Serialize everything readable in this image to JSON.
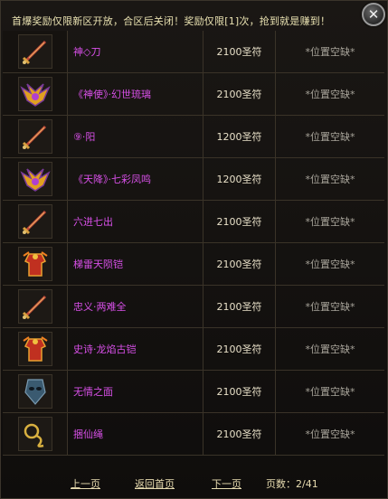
{
  "header": {
    "notice": "首爆奖励仅限新区开放，合区后关闭！奖励仅限[1]次，抢到就是赚到！"
  },
  "items": [
    {
      "name": "神◇刀",
      "price": "2100圣符",
      "slot": "*位置空缺*",
      "icon": "sword-icon"
    },
    {
      "name": "《神使》·幻世琉璃",
      "price": "2100圣符",
      "slot": "*位置空缺*",
      "icon": "winged-helmet-icon"
    },
    {
      "name": "⑨·阳",
      "price": "1200圣符",
      "slot": "*位置空缺*",
      "icon": "sword-icon"
    },
    {
      "name": "《天降》·七彩凤鸣",
      "price": "1200圣符",
      "slot": "*位置空缺*",
      "icon": "winged-helmet-icon"
    },
    {
      "name": "六进七出",
      "price": "2100圣符",
      "slot": "*位置空缺*",
      "icon": "sword-icon"
    },
    {
      "name": "梯雷天陨铠",
      "price": "2100圣符",
      "slot": "*位置空缺*",
      "icon": "armor-icon"
    },
    {
      "name": "忠义·两难全",
      "price": "2100圣符",
      "slot": "*位置空缺*",
      "icon": "sword-icon"
    },
    {
      "name": "史诗·龙焰古铠",
      "price": "2100圣符",
      "slot": "*位置空缺*",
      "icon": "armor-icon"
    },
    {
      "name": "无情之面",
      "price": "2100圣符",
      "slot": "*位置空缺*",
      "icon": "mask-icon"
    },
    {
      "name": "捆仙绳",
      "price": "2100圣符",
      "slot": "*位置空缺*",
      "icon": "rope-icon"
    }
  ],
  "footer": {
    "prev": "上一页",
    "home": "返回首页",
    "next": "下一页",
    "page": "页数：2/41"
  },
  "close_label": "✕"
}
